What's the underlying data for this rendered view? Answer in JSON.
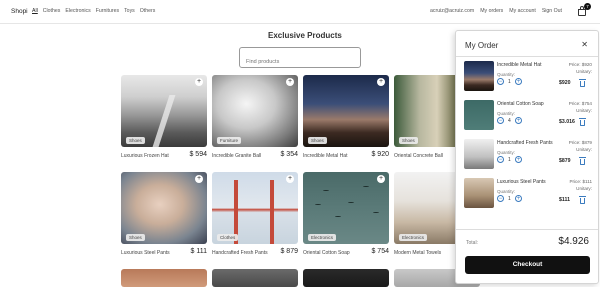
{
  "nav": {
    "brand": "Shopi",
    "categories": [
      "All",
      "Clothes",
      "Electronics",
      "Furnitures",
      "Toys",
      "Others"
    ],
    "email": "acruiz@acruiz.com",
    "my_orders": "My orders",
    "my_account": "My account",
    "sign_out": "Sign Out",
    "cart_count": "7",
    "cart_icon": "shopping-bag-icon"
  },
  "main": {
    "title": "Exclusive Products",
    "search_placeholder": "Find products",
    "add_icon": "plus-icon",
    "products": [
      {
        "name": "Luxurious Frozen Hat",
        "price": "$ 594",
        "badge": "Shoes"
      },
      {
        "name": "Incredible Granite Ball",
        "price": "$ 354",
        "badge": "Furniture"
      },
      {
        "name": "Incredible Metal Hat",
        "price": "$ 920",
        "badge": "Shoes"
      },
      {
        "name": "Oriental Concrete Ball",
        "price": "",
        "badge": "Shoes"
      },
      {
        "name": "Luxurious Steel Pants",
        "price": "$ 111",
        "badge": "Shoes"
      },
      {
        "name": "Handcrafted Fresh Pants",
        "price": "$ 879",
        "badge": "Clothes"
      },
      {
        "name": "Oriental Cotton Soap",
        "price": "$ 754",
        "badge": "Electronics"
      },
      {
        "name": "Modern Metal Towels",
        "price": "",
        "badge": "Electronics"
      }
    ]
  },
  "order": {
    "title": "My Order",
    "close_icon": "close-icon",
    "quantity_label": "Quantity:",
    "items": [
      {
        "name": "Incredible Metal Hat",
        "price": "Price: $920",
        "unitary": "Unitary:",
        "qty": "1",
        "total": "$920"
      },
      {
        "name": "Oriental Cotton Soap",
        "price": "Price: $754",
        "unitary": "Unitary:",
        "qty": "4",
        "total": "$3.016"
      },
      {
        "name": "Handcrafted Fresh Pants",
        "price": "Price: $879",
        "unitary": "Unitary:",
        "qty": "1",
        "total": "$879"
      },
      {
        "name": "Luxurious Steel Pants",
        "price": "Price: $111",
        "unitary": "Unitary:",
        "qty": "1",
        "total": "$111"
      }
    ],
    "total_label": "Total:",
    "total_value": "$4.926",
    "checkout_label": "Checkout"
  }
}
